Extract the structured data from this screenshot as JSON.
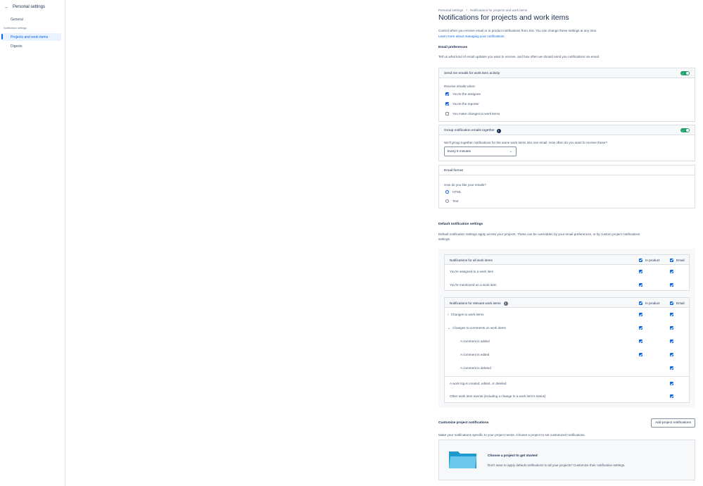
{
  "sidebar": {
    "title": "Personal settings",
    "general": "General",
    "section": "Notification settings",
    "items": [
      {
        "label": "Projects and work items"
      },
      {
        "label": "Digests"
      }
    ]
  },
  "breadcrumb": {
    "root": "Personal settings",
    "separator": "/",
    "current": "Notifications for projects and work items"
  },
  "page_title": "Notifications for projects and work items",
  "intro": {
    "text": "Control when you receive email or in product notifications from Jira. You can change these settings at any time.",
    "link": "Learn more about managing your notifications."
  },
  "email_preferences": {
    "heading": "Email preferences",
    "description": "Tell us what kind of email updates you want to receive, and how often we should send you notifications via email."
  },
  "send_emails": {
    "title": "Send me emails for work item activity",
    "enabled": true,
    "receive_label": "Receive emails when:",
    "options": [
      {
        "label": "You're the assignee",
        "checked": true
      },
      {
        "label": "You're the reporter",
        "checked": true
      },
      {
        "label": "You make changes to work items",
        "checked": false
      }
    ]
  },
  "group_emails": {
    "title": "Group notification emails together",
    "enabled": true,
    "description": "We'll group together notifications for the same work items into one email. How often do you want to receive these?",
    "selected": "Every 5 minutes"
  },
  "email_format": {
    "title": "Email format",
    "question": "How do you like your emails?",
    "options": [
      {
        "label": "HTML",
        "selected": true
      },
      {
        "label": "Text",
        "selected": false
      }
    ]
  },
  "default_settings": {
    "heading": "Default notification settings",
    "description_line1": "Default notification settings apply across your projects. These can be overridden by your email preferences, or by custom project notifications",
    "description_line2": "settings."
  },
  "table_all": {
    "title": "Notifications for all work items",
    "col_in_product": "In product",
    "col_email": "Email",
    "rows": [
      {
        "label": "You're assigned to a work item",
        "in_product": true,
        "email": true
      },
      {
        "label": "You're mentioned on a work item",
        "in_product": true,
        "email": true
      }
    ]
  },
  "table_relevant": {
    "title": "Notifications for relevant work items",
    "col_in_product": "In product",
    "col_email": "Email",
    "rows": [
      {
        "label": "Changes to work items",
        "in_product": true,
        "email": true
      },
      {
        "label": "Changes to comments on work items",
        "in_product": true,
        "email": true
      },
      {
        "label": "A comment is added",
        "in_product": true,
        "email": true
      },
      {
        "label": "A comment is edited",
        "in_product": true,
        "email": true
      },
      {
        "label": "A comment is deleted",
        "in_product": false,
        "email": true
      },
      {
        "label": "A work log is created, edited, or deleted",
        "in_product": false,
        "email": true
      },
      {
        "label": "Other work item events (including a change to a work item's status)",
        "in_product": false,
        "email": true
      }
    ]
  },
  "customize": {
    "heading": "Customize project notifications",
    "button": "Add project notifications",
    "description": "Make your notifications specific to your project needs. Choose a project to set customized notifications.",
    "empty_title": "Choose a project to get started",
    "empty_text": "Don't want to apply default notifications to all your projects? Customize their notification settings."
  },
  "colors": {
    "accent": "#0c66e4",
    "toggle_on": "#22a06b",
    "text": "#172b4d",
    "folder": "#1d9bd1"
  }
}
